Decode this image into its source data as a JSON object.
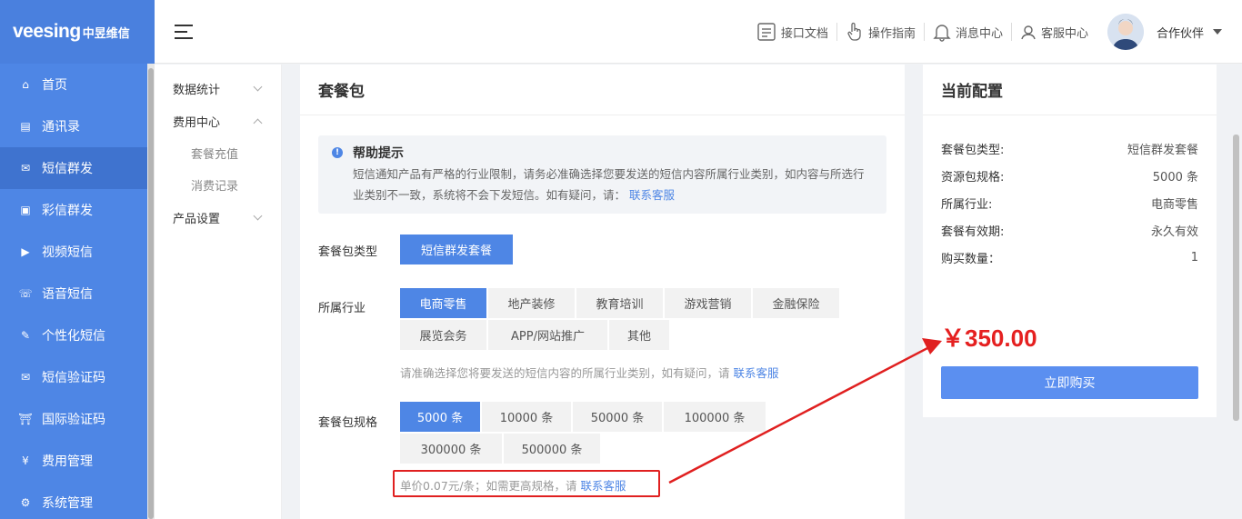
{
  "brand": {
    "logo_text": "veesing",
    "logo_cn": "中昱维信"
  },
  "sidebar": {
    "items": [
      {
        "label": "首页",
        "icon": "home-icon",
        "glyph": "⌂"
      },
      {
        "label": "通讯录",
        "icon": "contacts-icon",
        "glyph": "▤"
      },
      {
        "label": "短信群发",
        "icon": "sms-icon",
        "glyph": "✉",
        "active": true
      },
      {
        "label": "彩信群发",
        "icon": "mms-icon",
        "glyph": "▣"
      },
      {
        "label": "视频短信",
        "icon": "video-sms-icon",
        "glyph": "▶"
      },
      {
        "label": "语音短信",
        "icon": "voice-sms-icon",
        "glyph": "☏"
      },
      {
        "label": "个性化短信",
        "icon": "personalized-sms-icon",
        "glyph": "✎"
      },
      {
        "label": "短信验证码",
        "icon": "sms-code-icon",
        "glyph": "✉"
      },
      {
        "label": "国际验证码",
        "icon": "intl-code-icon",
        "glyph": "⛩"
      },
      {
        "label": "费用管理",
        "icon": "yen-icon",
        "glyph": "¥"
      },
      {
        "label": "系统管理",
        "icon": "gear-icon",
        "glyph": "⚙"
      }
    ]
  },
  "header": {
    "nav": [
      {
        "label": "接口文档",
        "icon": "api-doc-icon"
      },
      {
        "label": "操作指南",
        "icon": "hand-pointer-icon"
      },
      {
        "label": "消息中心",
        "icon": "bell-icon"
      },
      {
        "label": "客服中心",
        "icon": "customer-service-icon"
      }
    ],
    "user_name": "合作伙伴"
  },
  "submenu": {
    "groups": [
      {
        "label": "数据统计"
      },
      {
        "label": "费用中心",
        "children": [
          "套餐充值",
          "消费记录"
        ]
      },
      {
        "label": "产品设置"
      }
    ]
  },
  "main": {
    "title": "套餐包",
    "tip": {
      "icon_glyph": "!",
      "title": "帮助提示",
      "body": "短信通知产品有严格的行业限制，请务必准确选择您要发送的短信内容所属行业类别，如内容与所选行业类别不一致，系统将不会下发短信。如有疑问，请：",
      "link": "联系客服"
    },
    "package_type": {
      "label": "套餐包类型",
      "value": "短信群发套餐"
    },
    "industry": {
      "label": "所属行业",
      "options": [
        "电商零售",
        "地产装修",
        "教育培训",
        "游戏营销",
        "金融保险",
        "展览会务",
        "APP/网站推广",
        "其他"
      ],
      "selected": 0,
      "hint": "请准确选择您将要发送的短信内容的所属行业类别，如有疑问，请",
      "hint_link": "联系客服"
    },
    "spec": {
      "label": "套餐包规格",
      "options": [
        "5000 条",
        "10000 条",
        "50000 条",
        "100000 条",
        "300000 条",
        "500000 条"
      ],
      "selected": 0,
      "hint": "单价0.07元/条；如需更高规格，请",
      "hint_link": "联系客服"
    }
  },
  "summary": {
    "title": "当前配置",
    "rows": [
      {
        "k": "套餐包类型:",
        "v": "短信群发套餐"
      },
      {
        "k": "资源包规格:",
        "v": "5000 条"
      },
      {
        "k": "所属行业:",
        "v": "电商零售"
      },
      {
        "k": "套餐有效期:",
        "v": "永久有效"
      },
      {
        "k": "购买数量：",
        "v": "1"
      }
    ],
    "price": "￥350.00",
    "buy_label": "立即购买"
  },
  "colors": {
    "accent": "#4e86e5",
    "price": "#e52020",
    "annotation": "#e02020"
  }
}
